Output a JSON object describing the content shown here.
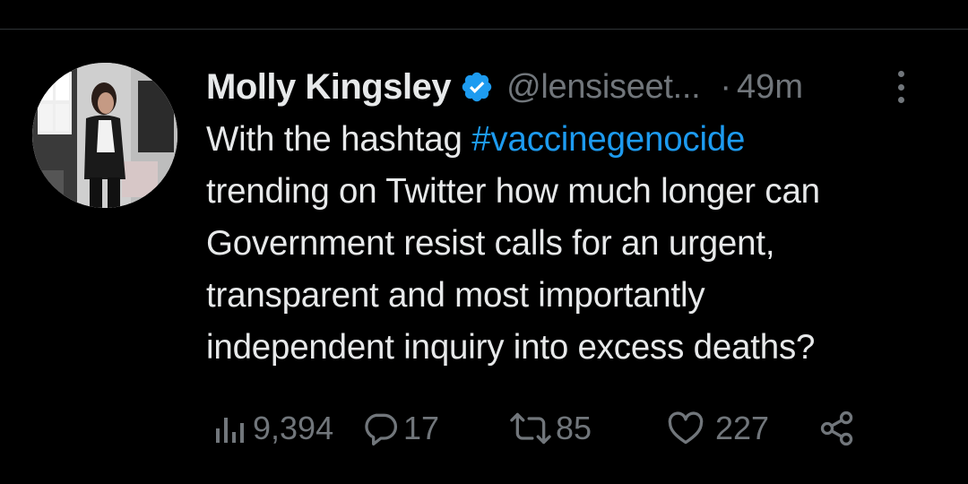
{
  "tweet": {
    "author": {
      "name": "Molly Kingsley",
      "handle": "@lensiseet...",
      "verified": true
    },
    "separator": "·",
    "time": "49m",
    "text": {
      "before_hashtag": "With the hashtag ",
      "hashtag": "#vaccinegenocide",
      "lines": [
        "trending on Twitter how much longer can",
        "Government resist calls for an urgent,",
        "transparent and most importantly",
        "independent inquiry into excess deaths?"
      ]
    },
    "stats": {
      "views": "9,394",
      "replies": "17",
      "retweets": "85",
      "likes": "227"
    }
  },
  "colors": {
    "background": "#000000",
    "text": "#e7e9ea",
    "muted": "#71767b",
    "link": "#1d9bf0",
    "verified_badge": "#1d9bf0"
  },
  "icons": {
    "verified": "verified-badge-icon",
    "more": "more-options-icon",
    "views": "views-bar-chart-icon",
    "reply": "reply-bubble-icon",
    "retweet": "retweet-icon",
    "like": "heart-icon",
    "share": "share-icon"
  }
}
